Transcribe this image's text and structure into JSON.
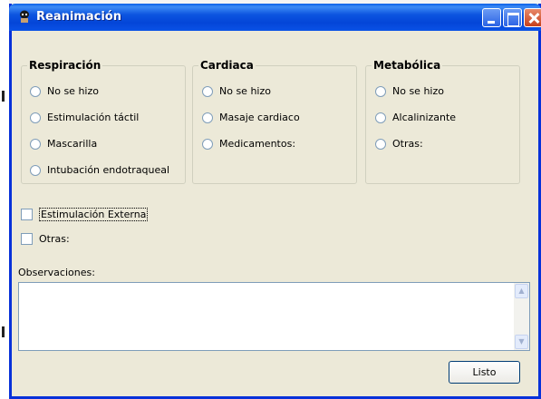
{
  "window": {
    "title": "Reanimación",
    "title_icon": "app-icon",
    "controls": [
      "minimize",
      "maximize",
      "close"
    ]
  },
  "groups": {
    "respiracion": {
      "title": "Respiración",
      "options": [
        "No se hizo",
        "Estimulación táctil",
        "Mascarilla",
        "Intubación endotraqueal"
      ]
    },
    "cardiaca": {
      "title": "Cardiaca",
      "options": [
        "No se hizo",
        "Masaje cardiaco",
        "Medicamentos:"
      ]
    },
    "metabolica": {
      "title": "Metabólica",
      "options": [
        "No se hizo",
        "Alcalinizante",
        "Otras:"
      ]
    }
  },
  "checks": {
    "estimulacion_externa": {
      "label": "Estimulación Externa",
      "checked": false
    },
    "otras": {
      "label": "Otras:",
      "checked": false
    }
  },
  "observaciones": {
    "label": "Observaciones:",
    "value": ""
  },
  "buttons": {
    "listo": "Listo"
  },
  "colors": {
    "titlebar": "#0a52e6",
    "window_face": "#ece9d8",
    "border": "#0831d9"
  }
}
